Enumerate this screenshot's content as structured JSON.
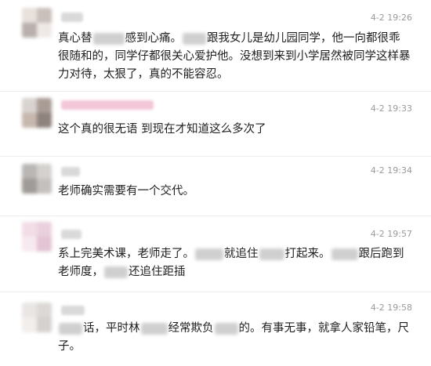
{
  "comments": [
    {
      "time": "4-2 19:26",
      "parts": {
        "p1": "真心替",
        "p2": "感到心痛。",
        "p3": "跟我女儿是幼儿园同学，他一向都很乖很随和的，同学仔都很关心爱护他。没想到来到小学居然被同学这样暴力对待，太狠了，真的不能容忍。"
      }
    },
    {
      "time": "4-2 19:33",
      "text": "这个真的很无语 到现在才知道这么多次了"
    },
    {
      "time": "4-2 19:34",
      "text": "老师确实需要有一个交代。"
    },
    {
      "time": "4-2 19:57",
      "parts": {
        "p1": "系上完美术课，老师走了。",
        "p2": "就追住",
        "p3": "打起来。",
        "p4": "跟后跑到老师度，",
        "p5": "还追住距插"
      }
    },
    {
      "time": "4-2 19:58",
      "parts": {
        "p1": "话，平时林",
        "p2": "经常欺负",
        "p3": "的。有事无事，就拿人家铅笔，尺子。"
      }
    }
  ],
  "colors": {
    "time": "#9a9a9a",
    "text": "#1e1e1e",
    "divider": "#ececec",
    "background": "#ffffff"
  }
}
